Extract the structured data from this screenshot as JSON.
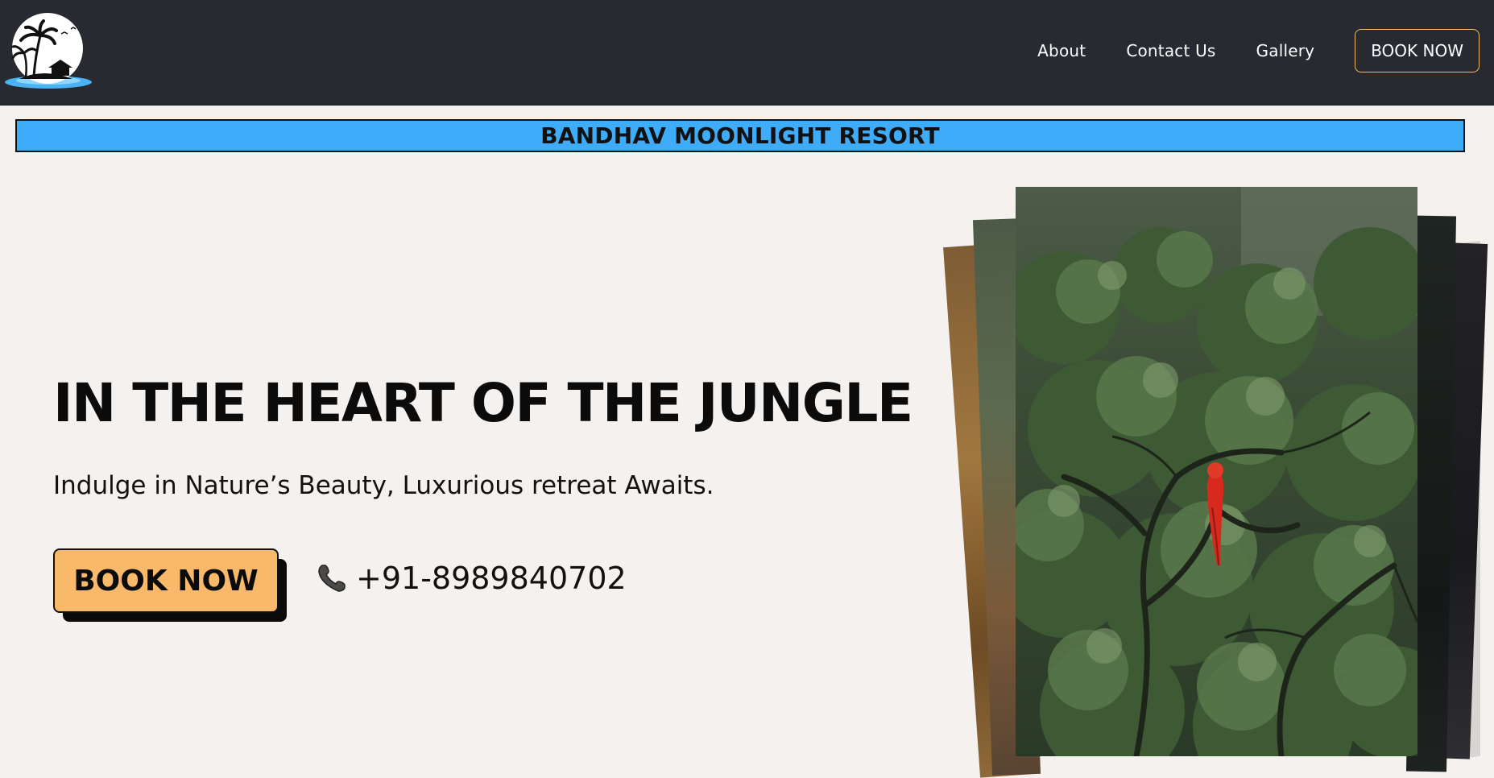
{
  "nav": {
    "logo_icon": "palm-island-logo-icon",
    "links": [
      "About",
      "Contact Us",
      "Gallery"
    ],
    "book_label": "BOOK NOW",
    "accent": "#f4b96a"
  },
  "banner": {
    "title": "BANDHAV MOONLIGHT RESORT",
    "color": "#3eacf8"
  },
  "hero": {
    "headline": "IN THE HEART OF THE JUNGLE",
    "subline": "Indulge in Nature’s Beauty, Luxurious retreat Awaits.",
    "book_label": "BOOK NOW",
    "book_color": "#f8ba6a",
    "phone_icon": "phone-icon",
    "phone": "+91-8989840702"
  },
  "gallery": {
    "front_image": "parrot-in-jungle-tree-image"
  }
}
